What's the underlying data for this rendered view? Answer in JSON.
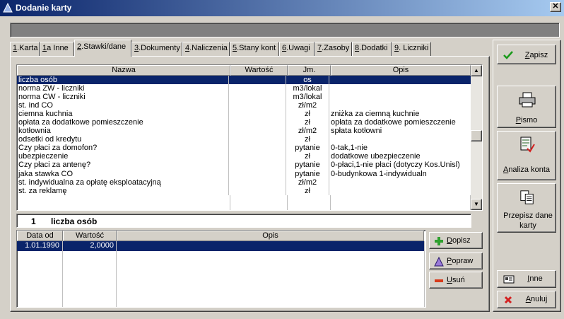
{
  "window": {
    "title": "Dodanie karty",
    "close_glyph": "✕"
  },
  "tabs": [
    {
      "hot": "1",
      "label": ".Karta"
    },
    {
      "hot": "1",
      "label": "a Inne"
    },
    {
      "hot": "2",
      "label": ".Stawki/dane"
    },
    {
      "hot": "3",
      "label": ".Dokumenty"
    },
    {
      "hot": "4",
      "label": ".Naliczenia"
    },
    {
      "hot": "5",
      "label": ".Stany kont"
    },
    {
      "hot": "6",
      "label": ".Uwagi"
    },
    {
      "hot": "7",
      "label": ".Zasoby"
    },
    {
      "hot": "8",
      "label": ".Dodatki"
    },
    {
      "hot": "9",
      "label": ". Liczniki"
    }
  ],
  "params_grid": {
    "columns": [
      "Nazwa",
      "Wartość",
      "Jm.",
      "Opis"
    ],
    "rows": [
      {
        "name": "liczba osób",
        "value": "",
        "unit": "os",
        "desc": ""
      },
      {
        "name": "norma ZW - liczniki",
        "value": "",
        "unit": "m3/lokal",
        "desc": ""
      },
      {
        "name": "norma CW - liczniki",
        "value": "",
        "unit": "m3/lokal",
        "desc": ""
      },
      {
        "name": "st. ind CO",
        "value": "",
        "unit": "zł/m2",
        "desc": ""
      },
      {
        "name": "ciemna kuchnia",
        "value": "",
        "unit": "zł",
        "desc": "zniżka za ciemną kuchnie"
      },
      {
        "name": "opłata za dodatkowe pomieszczenie",
        "value": "",
        "unit": "zł",
        "desc": "opłata za dodatkowe pomieszczenie"
      },
      {
        "name": "kotłownia",
        "value": "",
        "unit": "zł/m2",
        "desc": "spłata kotłowni"
      },
      {
        "name": "odsetki od kredytu",
        "value": "",
        "unit": "zł",
        "desc": ""
      },
      {
        "name": "Czy płaci za domofon?",
        "value": "",
        "unit": "pytanie",
        "desc": "0-tak,1-nie"
      },
      {
        "name": "ubezpieczenie",
        "value": "",
        "unit": "zł",
        "desc": "dodatkowe ubezpieczenie"
      },
      {
        "name": "Czy płaci za antenę?",
        "value": "",
        "unit": "pytanie",
        "desc": "0-płaci,1-nie płaci (dotyczy Kos.Unisl)"
      },
      {
        "name": "jaka stawka CO",
        "value": "",
        "unit": "pytanie",
        "desc": "0-budynkowa 1-indywidualn"
      },
      {
        "name": "st. indywidualna za opłatę eksploatacyjną",
        "value": "",
        "unit": "zł/m2",
        "desc": ""
      },
      {
        "name": "st. za reklamę",
        "value": "",
        "unit": "zł",
        "desc": ""
      }
    ],
    "selected_index": 0,
    "scroll_up": "▲",
    "scroll_down": "▼"
  },
  "selected_item": {
    "number": "1",
    "name": "liczba osób"
  },
  "history_grid": {
    "columns": [
      "Data od",
      "Wartość",
      "Opis"
    ],
    "rows": [
      {
        "date": "1.01.1990",
        "value": "2,0000",
        "desc": ""
      }
    ]
  },
  "history_buttons": {
    "add": {
      "hot": "D",
      "rest": "opisz"
    },
    "edit": {
      "hot": "P",
      "rest": "opraw"
    },
    "delete": {
      "hot": "U",
      "rest": "suń"
    }
  },
  "side_buttons": {
    "save": {
      "hot": "Z",
      "rest": "apisz"
    },
    "letter": {
      "hot": "P",
      "rest": "ismo"
    },
    "account": {
      "hot": "A",
      "rest": "naliza konta"
    },
    "copy": {
      "label": "Przepisz dane karty"
    },
    "other": {
      "hot": "I",
      "rest": "nne"
    },
    "cancel": {
      "hot": "A",
      "rest": "nuluj"
    }
  },
  "colors": {
    "selection": "#0a246a",
    "face": "#d4d0c8",
    "save_check": "#1a9a1a",
    "cancel_x": "#d42020"
  }
}
